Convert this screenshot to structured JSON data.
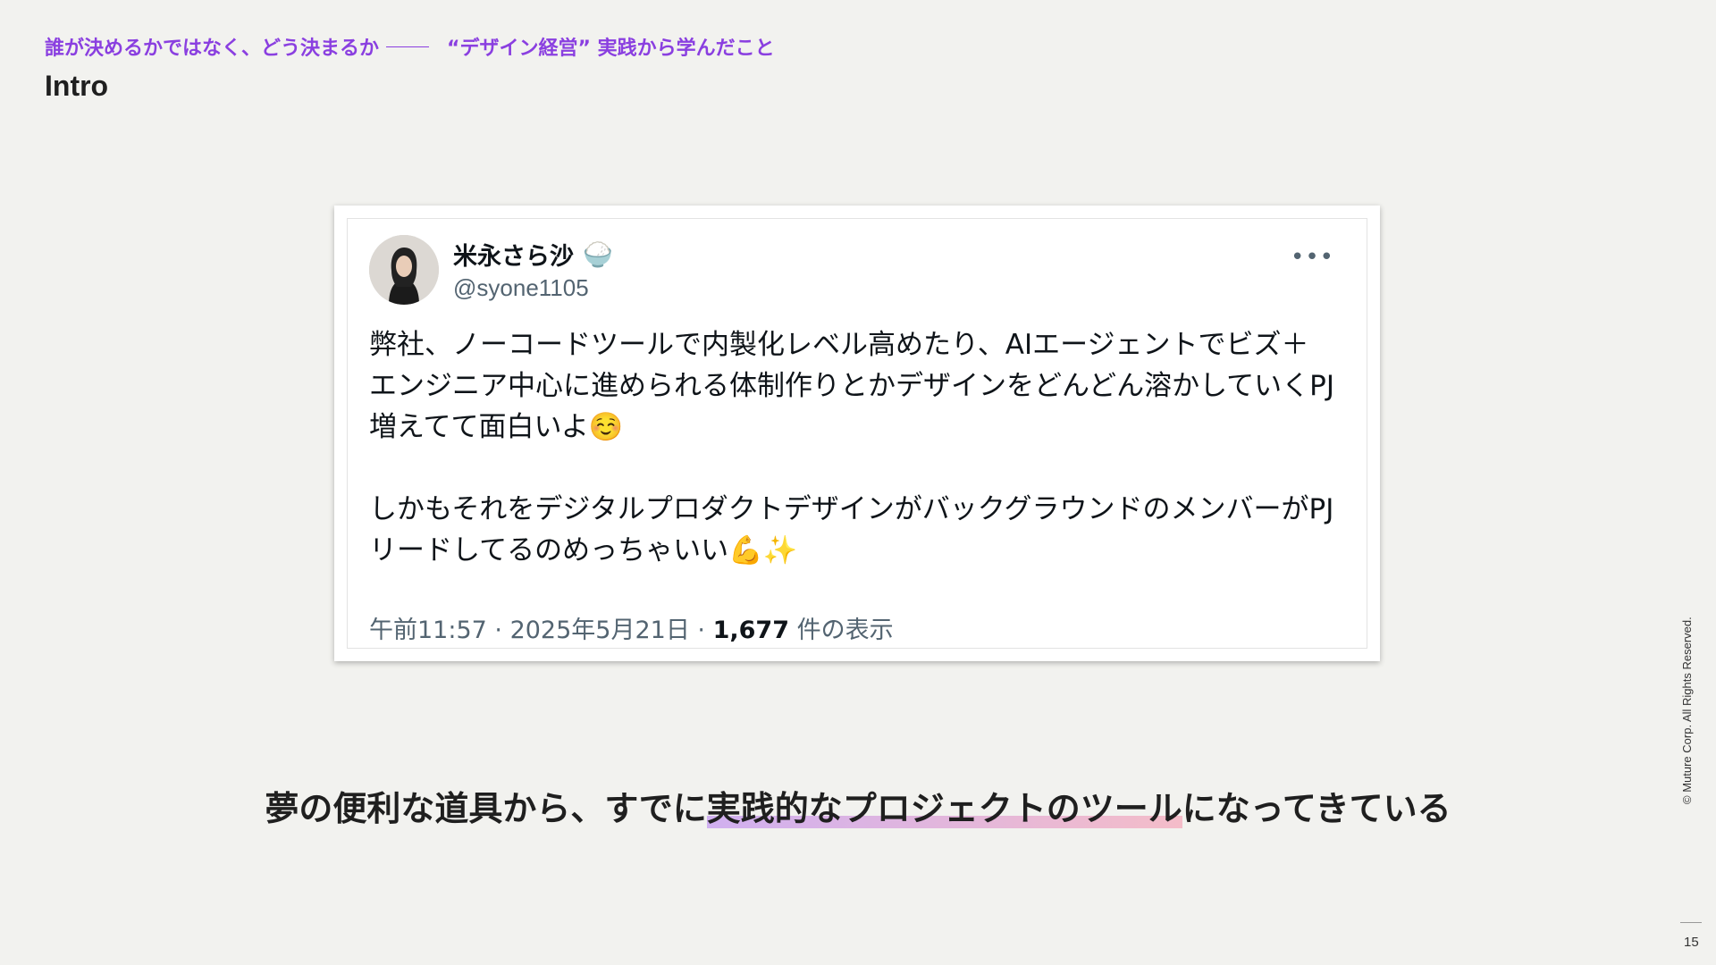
{
  "header": {
    "subtitle_left": "誰が決めるかではなく、どう決まるか",
    "subtitle_right": "“デザイン経営” 実践から学んだこと",
    "title": "Intro"
  },
  "tweet": {
    "author_name": "米永さら沙",
    "author_emoji": "🍚",
    "handle": "@syone1105",
    "paragraph_1": "弊社、ノーコードツールで内製化レベル高めたり、AIエージェントでビズ＋エンジニア中心に進められる体制作りとかデザインをどんどん溶かしていくPJ増えてて面白いよ☺️",
    "paragraph_2": "しかもそれをデジタルプロダクトデザインがバックグラウンドのメンバーがPJリードしてるのめっちゃいい💪✨",
    "time": "午前11:57",
    "date": "2025年5月21日",
    "views_count": "1,677",
    "views_label": "件の表示",
    "more_icon": "more-horizontal-icon"
  },
  "caption": {
    "before": "夢の便利な道具から、すでに",
    "highlight": "実践的なプロジェクトのツール",
    "after": "になってきている"
  },
  "footer": {
    "copyright": "© Muture Corp. All Rights Reserved.",
    "page_number": "15"
  },
  "colors": {
    "accent": "#8a3fe0",
    "background": "#f2f2ef",
    "highlight_start": "#be8cf0",
    "highlight_end": "#f5a0b4"
  }
}
